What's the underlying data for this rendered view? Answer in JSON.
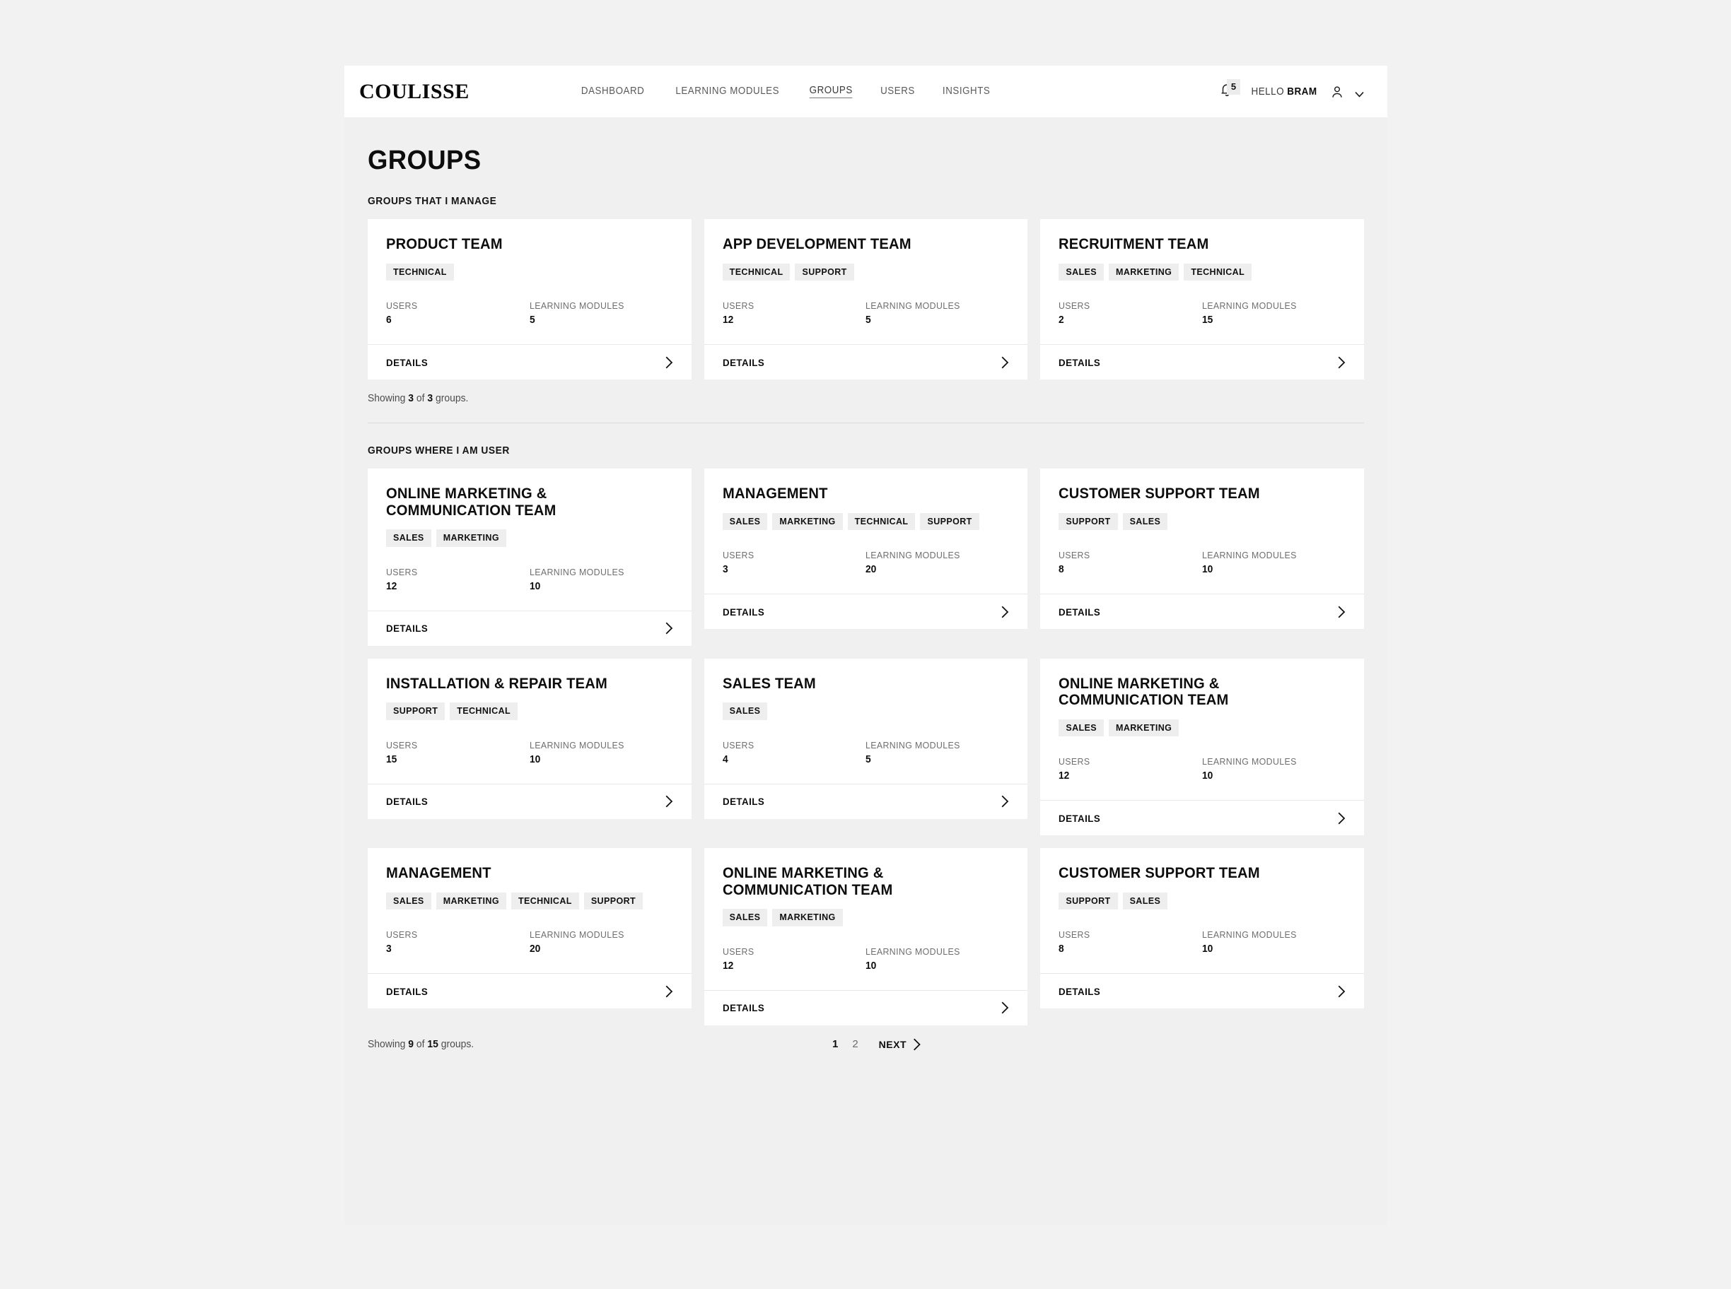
{
  "header": {
    "brand": "COULISSE",
    "nav": [
      {
        "label": "DASHBOARD",
        "active": false
      },
      {
        "label": "LEARNING MODULES",
        "active": false
      },
      {
        "label": "GROUPS",
        "active": true
      },
      {
        "label": "USERS",
        "active": false
      },
      {
        "label": "INSIGHTS",
        "active": false
      }
    ],
    "notification_count": "5",
    "greeting_prefix": "HELLO ",
    "user_name": "BRAM",
    "bell_icon": "bell-icon",
    "avatar_icon": "person-icon",
    "caret_icon": "chevron-down-icon"
  },
  "page": {
    "title": "GROUPS"
  },
  "labels": {
    "users": "USERS",
    "learning_modules": "LEARNING MODULES",
    "details": "DETAILS"
  },
  "sections": [
    {
      "title": "GROUPS THAT I MANAGE",
      "showing_prefix": "Showing ",
      "showing_count": "3",
      "showing_mid": " of ",
      "showing_total": "3",
      "showing_suffix": " groups.",
      "cards": [
        {
          "title": "PRODUCT TEAM",
          "tags": [
            "TECHNICAL"
          ],
          "users": "6",
          "modules": "5"
        },
        {
          "title": "APP DEVELOPMENT TEAM",
          "tags": [
            "TECHNICAL",
            "SUPPORT"
          ],
          "users": "12",
          "modules": "5"
        },
        {
          "title": "RECRUITMENT TEAM",
          "tags": [
            "SALES",
            "MARKETING",
            "TECHNICAL"
          ],
          "users": "2",
          "modules": "15"
        }
      ]
    },
    {
      "title": "GROUPS WHERE I AM USER",
      "showing_prefix": "Showing ",
      "showing_count": "9",
      "showing_mid": " of ",
      "showing_total": "15",
      "showing_suffix": " groups.",
      "cards": [
        {
          "title": "ONLINE MARKETING & COMMUNICATION TEAM",
          "tags": [
            "SALES",
            "MARKETING"
          ],
          "users": "12",
          "modules": "10"
        },
        {
          "title": "MANAGEMENT",
          "tags": [
            "SALES",
            "MARKETING",
            "TECHNICAL",
            "SUPPORT"
          ],
          "users": "3",
          "modules": "20"
        },
        {
          "title": "CUSTOMER SUPPORT TEAM",
          "tags": [
            "SUPPORT",
            "SALES"
          ],
          "users": "8",
          "modules": "10"
        },
        {
          "title": "INSTALLATION & REPAIR TEAM",
          "tags": [
            "SUPPORT",
            "TECHNICAL"
          ],
          "users": "15",
          "modules": "10"
        },
        {
          "title": "SALES TEAM",
          "tags": [
            "SALES"
          ],
          "users": "4",
          "modules": "5"
        },
        {
          "title": "ONLINE MARKETING & COMMUNICATION TEAM",
          "tags": [
            "SALES",
            "MARKETING"
          ],
          "users": "12",
          "modules": "10"
        },
        {
          "title": "MANAGEMENT",
          "tags": [
            "SALES",
            "MARKETING",
            "TECHNICAL",
            "SUPPORT"
          ],
          "users": "3",
          "modules": "20"
        },
        {
          "title": "ONLINE MARKETING & COMMUNICATION TEAM",
          "tags": [
            "SALES",
            "MARKETING"
          ],
          "users": "12",
          "modules": "10"
        },
        {
          "title": "CUSTOMER SUPPORT TEAM",
          "tags": [
            "SUPPORT",
            "SALES"
          ],
          "users": "8",
          "modules": "10"
        }
      ]
    }
  ],
  "pagination": {
    "pages": [
      {
        "label": "1",
        "active": true
      },
      {
        "label": "2",
        "active": false
      }
    ],
    "next_label": "NEXT",
    "next_icon": "chevron-right-icon"
  },
  "colors": {
    "page_bg": "#f2f2f2",
    "app_bg": "#f0f0f0",
    "card_bg": "#ffffff",
    "tag_bg": "#eeeeee",
    "text": "#0d0d0d",
    "muted": "#6e6e6e"
  }
}
